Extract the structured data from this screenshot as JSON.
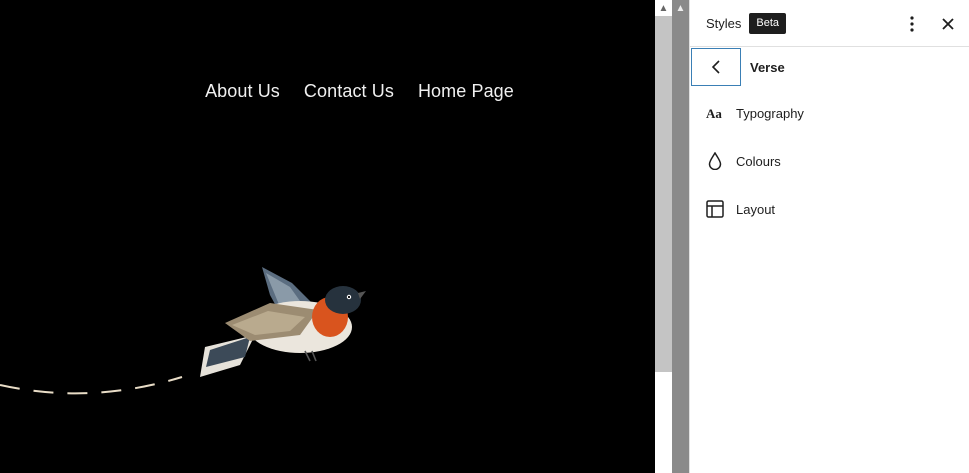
{
  "site": {
    "nav": [
      "About Us",
      "Contact Us",
      "Home Page"
    ]
  },
  "panel": {
    "title": "Styles",
    "badge": "Beta",
    "section_title": "Verse",
    "items": [
      {
        "label": "Typography",
        "icon": "typography-icon"
      },
      {
        "label": "Colours",
        "icon": "droplet-icon"
      },
      {
        "label": "Layout",
        "icon": "layout-icon"
      }
    ]
  },
  "colors": {
    "canvas_bg": "#000000",
    "accent": "#3a7fb5",
    "badge_bg": "#1e1e1e"
  }
}
